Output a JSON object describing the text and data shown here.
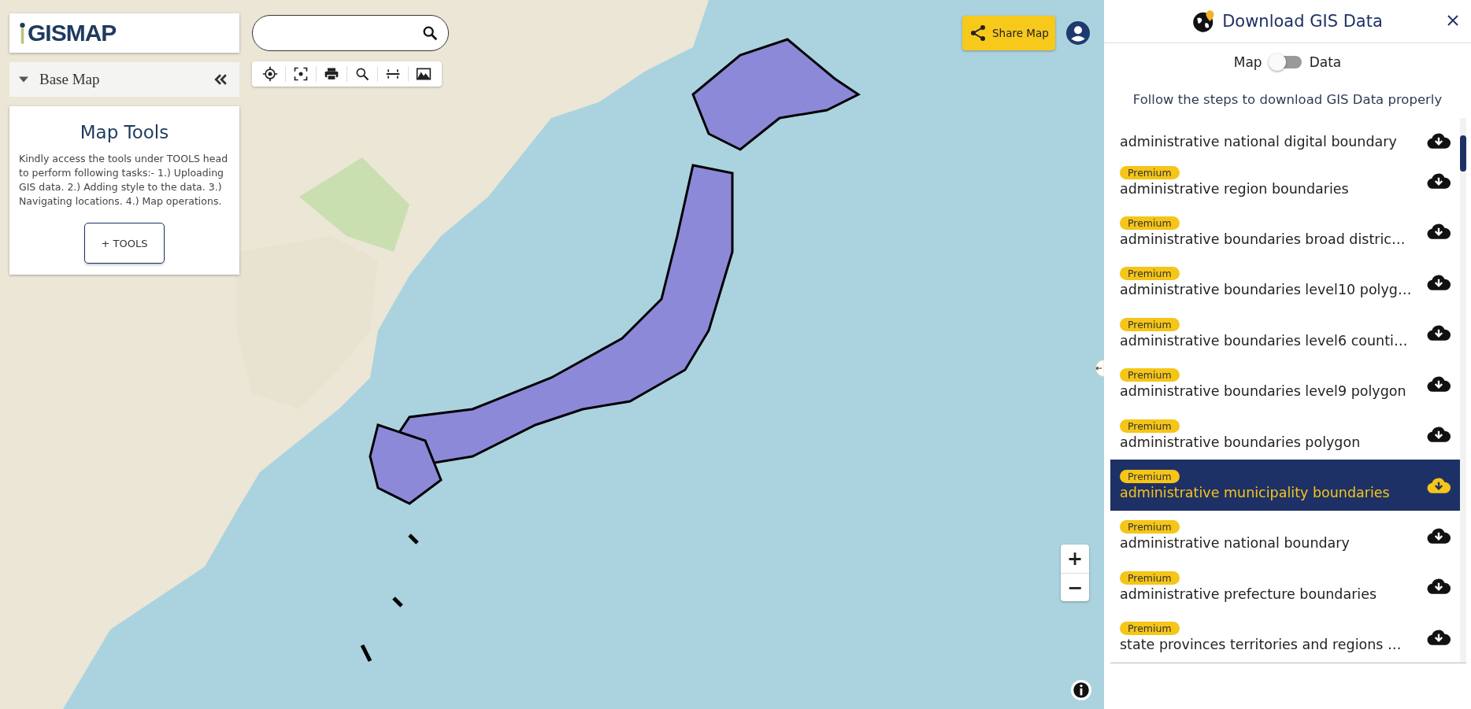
{
  "logo": {
    "text": "GISMAP"
  },
  "base_map": {
    "label": "Base Map",
    "expanded": true
  },
  "map_tools": {
    "title": "Map Tools",
    "text": "Kindly access the tools under TOOLS head to perform following tasks:- 1.) Uploading GIS data. 2.) Adding style to the data. 3.) Navigating locations. 4.) Map operations.",
    "button": "+ TOOLS"
  },
  "share_button": "Share Map",
  "zoom": {
    "in": "+",
    "out": "−"
  },
  "panel": {
    "title": "Download GIS Data",
    "toggle": {
      "left": "Map",
      "right": "Data",
      "on": false
    },
    "instruction": "Follow the steps to download GIS Data properly",
    "items": [
      {
        "name": "administrative national digital boundary",
        "selected": false
      },
      {
        "badge": "Premium",
        "name": "administrative region boundaries",
        "selected": false
      },
      {
        "badge": "Premium",
        "name": "administrative boundaries broad distric…",
        "selected": false
      },
      {
        "badge": "Premium",
        "name": "administrative boundaries level10 polyg…",
        "selected": false
      },
      {
        "badge": "Premium",
        "name": "administrative boundaries level6 counti…",
        "selected": false
      },
      {
        "badge": "Premium",
        "name": "administrative boundaries level9 polygon",
        "selected": false
      },
      {
        "badge": "Premium",
        "name": "administrative boundaries polygon",
        "selected": false
      },
      {
        "badge": "Premium",
        "name": "administrative municipality boundaries",
        "selected": true
      },
      {
        "badge": "Premium",
        "name": "administrative national boundary",
        "selected": false
      },
      {
        "badge": "Premium",
        "name": "administrative prefecture boundaries",
        "selected": false
      },
      {
        "badge": "Premium",
        "name": "state provinces territories and regions …",
        "selected": false
      }
    ]
  }
}
